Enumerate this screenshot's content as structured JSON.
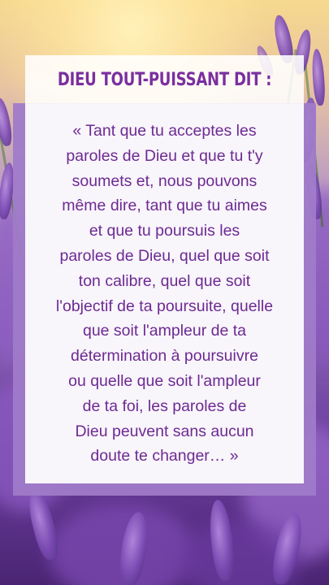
{
  "header": {
    "title": "DIEU TOUT-PUISSANT DIT :"
  },
  "quote": {
    "lines": [
      "« Tant que tu acceptes les",
      "paroles de Dieu et que tu t'y",
      "soumets et, nous pouvons",
      "même dire, tant que tu aimes",
      "et que tu poursuis les",
      "paroles de Dieu, quel que soit",
      "ton calibre, quel que soit",
      "l'objectif de ta poursuite, quelle",
      "que soit l'ampleur de ta",
      "détermination à poursuivre",
      "ou quelle que soit l'ampleur",
      "de ta foi, les paroles de",
      "Dieu peuvent sans aucun",
      "doute te changer… »"
    ]
  },
  "colors": {
    "title": "#7a2fa0",
    "text": "#6d2a92",
    "frame": "#a07bc9",
    "card": "#f8f5fb"
  },
  "background": {
    "subject": "lavender field at sunset"
  }
}
